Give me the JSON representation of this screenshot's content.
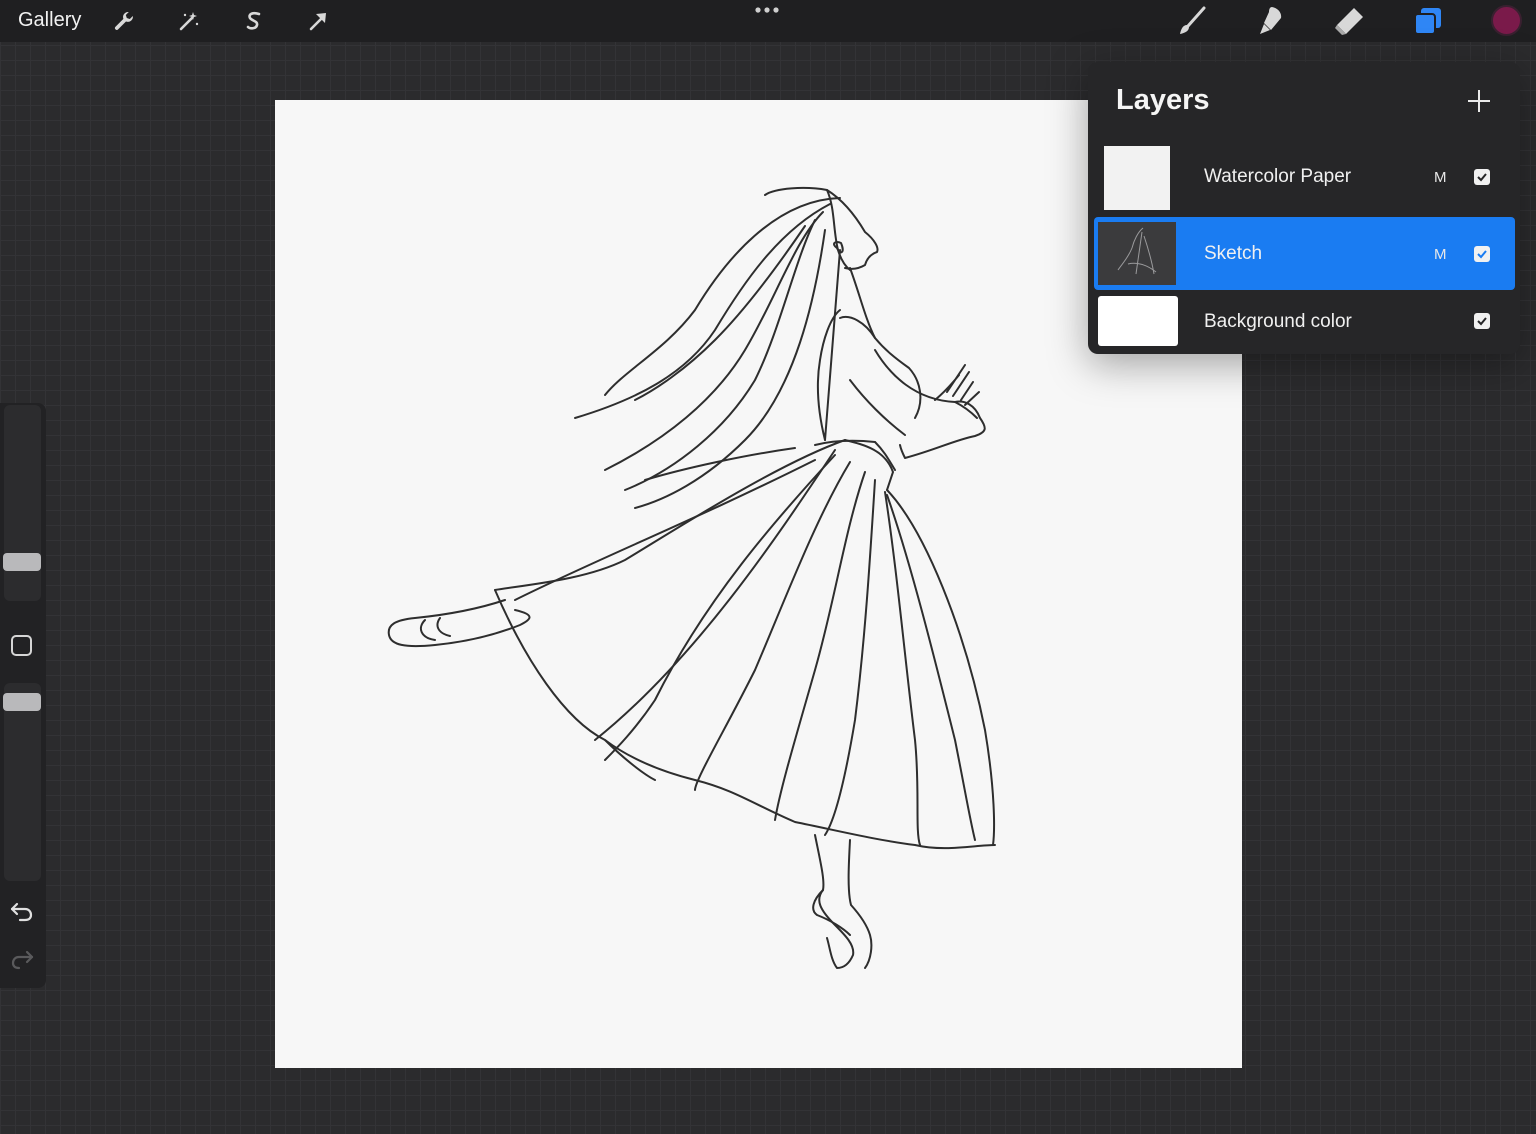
{
  "toolbar": {
    "gallery_label": "Gallery",
    "left_tools": [
      "wrench-icon",
      "magic-wand-icon",
      "selection-s-icon",
      "transform-arrow-icon"
    ],
    "right_tools": [
      "brush-icon",
      "smudge-icon",
      "eraser-icon",
      "layers-icon"
    ],
    "current_color": "#7a1a4a"
  },
  "sidebar": {
    "brush_size": 0.25,
    "opacity": 0.9
  },
  "layers_panel": {
    "title": "Layers",
    "layers": [
      {
        "name": "Watercolor Paper",
        "blend_mode": "M",
        "visible": true,
        "active": false
      },
      {
        "name": "Sketch",
        "blend_mode": "M",
        "visible": true,
        "active": true
      },
      {
        "name": "Background color",
        "blend_mode": "",
        "visible": true,
        "active": false
      }
    ]
  },
  "colors": {
    "accent": "#1a7cf2",
    "active_tool": "#2f86f5",
    "canvas": "#f7f7f7"
  }
}
